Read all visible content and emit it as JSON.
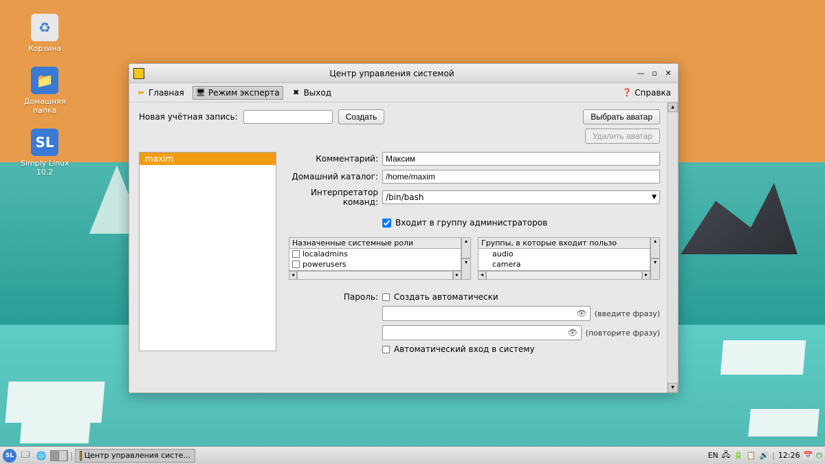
{
  "desktop": {
    "icons": {
      "trash": "Корзина",
      "home": "Домашняя\nпапка",
      "sl": "Simply Linux\n10.2"
    }
  },
  "window": {
    "title": "Центр управления системой"
  },
  "toolbar": {
    "home": "Главная",
    "expert": "Режим эксперта",
    "exit": "Выход",
    "help": "Справка"
  },
  "newuser": {
    "label": "Новая учётная запись:",
    "create_btn": "Создать"
  },
  "avatar": {
    "choose": "Выбрать аватар",
    "delete": "Удалить аватар"
  },
  "userlist": {
    "selected": "maxim"
  },
  "fields": {
    "comment_label": "Комментарий:",
    "comment_value": "Максим",
    "homedir_label": "Домашний каталог:",
    "homedir_value": "/home/maxim",
    "shell_label": "Интерпретатор команд:",
    "shell_value": "/bin/bash",
    "admin_group": "Входит в группу администраторов"
  },
  "roles": {
    "header": "Назначенные системные роли",
    "items": [
      "localadmins",
      "powerusers"
    ]
  },
  "groups": {
    "header": "Группы, в которые входит пользо",
    "items": [
      "audio",
      "camera"
    ]
  },
  "password": {
    "label": "Пароль:",
    "autogen": "Создать автоматически",
    "hint1": "(введите фразу)",
    "hint2": "(повторите фразу)",
    "autologin": "Автоматический вход в систему"
  },
  "panel": {
    "task": "Центр управления систе...",
    "lang": "EN",
    "time": "12:26"
  }
}
